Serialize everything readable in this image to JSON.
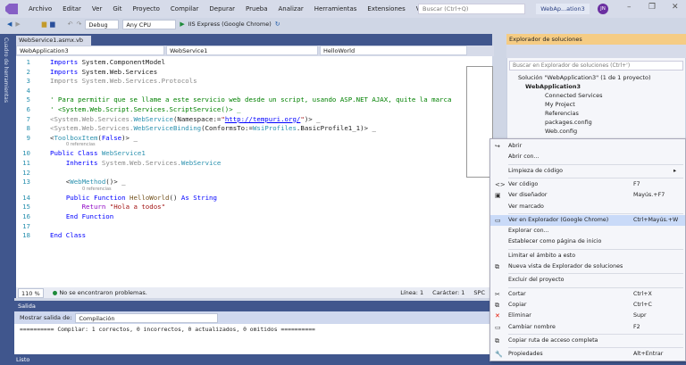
{
  "menubar": {
    "items": [
      "Archivo",
      "Editar",
      "Ver",
      "Git",
      "Proyecto",
      "Compilar",
      "Depurar",
      "Prueba",
      "Analizar",
      "Herramientas",
      "Extensiones",
      "Ventana",
      "Ayuda"
    ],
    "search_placeholder": "Buscar (Ctrl+Q)",
    "project": "WebAp...ation3",
    "avatar": "JN"
  },
  "toolbar": {
    "config": "Debug",
    "platform": "Any CPU",
    "run": "IIS Express (Google Chrome)"
  },
  "left_strip": "Cuadro de herramientas",
  "editor": {
    "tab": "WebService1.asmx.vb",
    "nav": [
      "WebApplication3",
      "WebService1",
      "HelloWorld"
    ],
    "lines": [
      {
        "n": "1",
        "html": "<span class='kw'>Imports</span> System.ComponentModel"
      },
      {
        "n": "2",
        "html": "<span class='kw'>Imports</span> System.Web.Services"
      },
      {
        "n": "3",
        "html": "<span class='gr'>Imports System.Web.Services.Protocols</span>"
      },
      {
        "n": "4",
        "html": ""
      },
      {
        "n": "5",
        "html": "<span class='cm'>' Para permitir que se llame a este servicio web desde un script, usando ASP.NET AJAX, quite la marca</span>"
      },
      {
        "n": "6",
        "html": "<span class='cm'>' &lt;System.Web.Script.Services.ScriptService()&gt; _</span>"
      },
      {
        "n": "7",
        "html": "<span class='gr'>&lt;System.Web.Services.</span><span class='ty'>WebService</span>(Namespace:=<span class='str'>\"</span><span class='lnk'>http://tempuri.org/</span><span class='str'>\"</span>)&gt; _"
      },
      {
        "n": "8",
        "html": "<span class='gr'>&lt;System.Web.Services.</span><span class='ty'>WebServiceBinding</span>(ConformsTo:=<span class='ty'>WsiProfiles</span>.BasicProfile1_1)&gt; _"
      },
      {
        "n": "9",
        "html": "&lt;<span class='ty'>ToolboxItem</span>(<span class='kw'>False</span>)&gt; _",
        "ref": "0 referencias"
      },
      {
        "n": "10",
        "html": "<span class='kw'>Public Class</span> <span class='ty'>WebService1</span>"
      },
      {
        "n": "11",
        "html": "    <span class='kw'>Inherits</span> <span class='gr'>System.Web.Services.</span><span class='ty'>WebService</span>"
      },
      {
        "n": "12",
        "html": ""
      },
      {
        "n": "13",
        "html": "    &lt;<span class='ty'>WebMethod</span>()&gt; _",
        "ref": "0 referencias"
      },
      {
        "n": "14",
        "html": "    <span class='kw'>Public Function</span> <span class='fn'>HelloWorld</span>() <span class='kw'>As String</span>"
      },
      {
        "n": "15",
        "html": "        <span class='ret'>Return</span> <span class='str'>\"Hola a todos\"</span>"
      },
      {
        "n": "16",
        "html": "    <span class='kw'>End Function</span>"
      },
      {
        "n": "17",
        "html": ""
      },
      {
        "n": "18",
        "html": "<span class='kw'>End Class</span>"
      }
    ],
    "status": {
      "zoom": "110 %",
      "problems": "No se encontraron problemas.",
      "line": "Línea: 1",
      "char": "Carácter: 1",
      "spc": "SPC"
    }
  },
  "output": {
    "title": "Salida",
    "show_label": "Mostrar salida de:",
    "source": "Compilación",
    "text": "========== Compilar: 1 correctos, 0 incorrectos, 0 actualizados, 0 omitidos =========="
  },
  "statusbar": {
    "text": "Listo"
  },
  "solution_explorer": {
    "title": "Explorador de soluciones",
    "search_placeholder": "Buscar en Explorador de soluciones (Ctrl+')",
    "tree": [
      "Solución \"WebApplication3\" (1 de 1 proyecto)",
      "WebApplication3",
      "Connected Services",
      "My Project",
      "Referencias",
      "packages.config",
      "Web.config"
    ]
  },
  "context_menu": [
    {
      "label": "Abrir",
      "icon": "open-icon",
      "sym": "↪"
    },
    {
      "label": "Abrir con..."
    },
    {
      "sep": true
    },
    {
      "label": "Limpieza de código",
      "sub": "▸"
    },
    {
      "sep": true
    },
    {
      "label": "Ver código",
      "icon": "code-icon",
      "sym": "<>",
      "shortcut": "F7"
    },
    {
      "label": "Ver diseñador",
      "icon": "designer-icon",
      "sym": "▣",
      "shortcut": "Mayús.+F7"
    },
    {
      "label": "Ver marcado"
    },
    {
      "sep": true
    },
    {
      "label": "Ver en Explorador (Google Chrome)",
      "icon": "browser-icon",
      "sym": "▭",
      "shortcut": "Ctrl+Mayús.+W",
      "highlight": true
    },
    {
      "label": "Explorar con..."
    },
    {
      "label": "Establecer como página de inicio"
    },
    {
      "sep": true
    },
    {
      "label": "Limitar el ámbito a esto"
    },
    {
      "label": "Nueva vista de Explorador de soluciones",
      "icon": "new-view-icon",
      "sym": "⧉"
    },
    {
      "sep": true
    },
    {
      "label": "Excluir del proyecto"
    },
    {
      "sep": true
    },
    {
      "label": "Cortar",
      "icon": "cut-icon",
      "sym": "✂",
      "shortcut": "Ctrl+X"
    },
    {
      "label": "Copiar",
      "icon": "copy-icon",
      "sym": "⧉",
      "shortcut": "Ctrl+C"
    },
    {
      "label": "Eliminar",
      "icon": "delete-icon",
      "sym": "✕",
      "shortcut": "Supr",
      "color": "#e51400"
    },
    {
      "label": "Cambiar nombre",
      "icon": "rename-icon",
      "sym": "▭",
      "shortcut": "F2"
    },
    {
      "sep": true
    },
    {
      "label": "Copiar ruta de acceso completa",
      "icon": "copy-path-icon",
      "sym": "⧉"
    },
    {
      "sep": true
    },
    {
      "label": "Propiedades",
      "icon": "wrench-icon",
      "sym": "🔧",
      "shortcut": "Alt+Entrar"
    }
  ]
}
